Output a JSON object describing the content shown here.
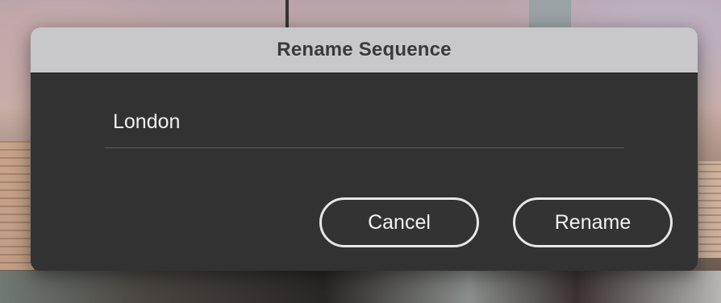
{
  "dialog": {
    "title": "Rename Sequence",
    "name_field": {
      "value": "London"
    },
    "buttons": {
      "cancel_label": "Cancel",
      "rename_label": "Rename"
    }
  },
  "colors": {
    "titlebar": "#c8c8ca",
    "dialog_body": "#323232",
    "button_border": "#e6e6e6",
    "text_light": "#f0f0f0"
  }
}
